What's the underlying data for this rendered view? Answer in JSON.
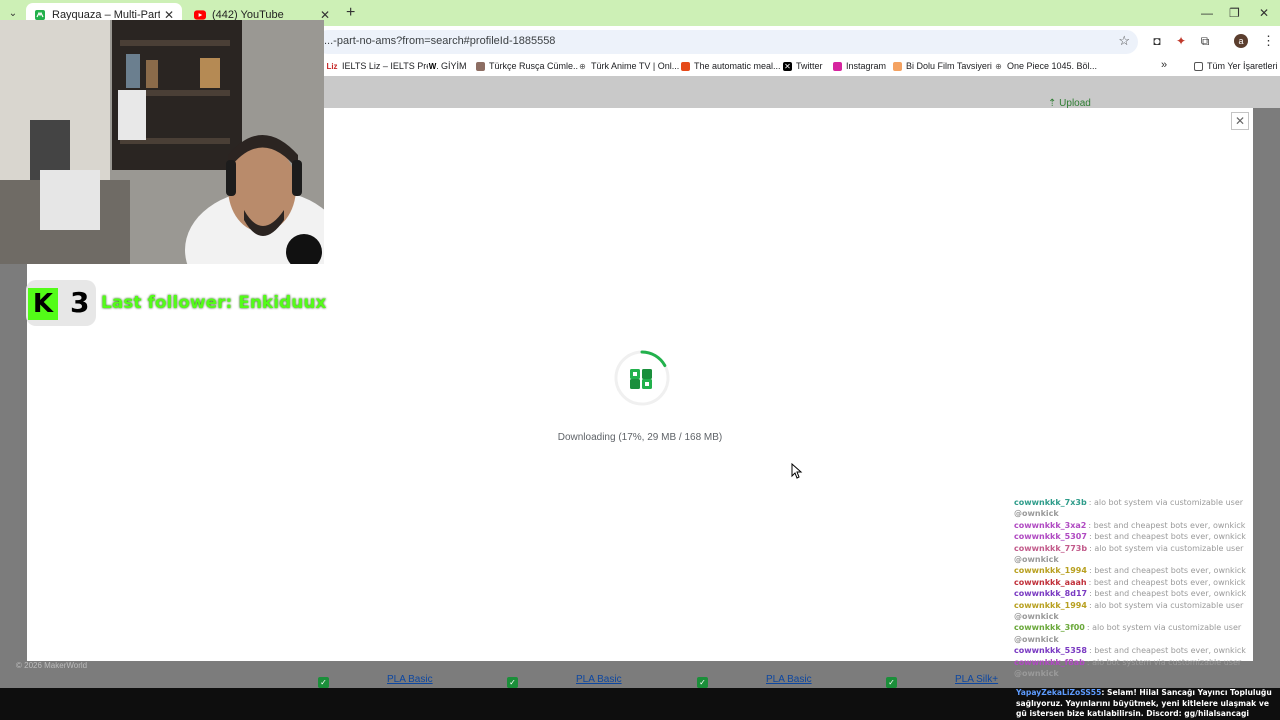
{
  "browser": {
    "tabs": [
      {
        "title": "Rayquaza – Multi-Part (No AMS",
        "active": true
      },
      {
        "title": "(442) YouTube",
        "active": false
      }
    ],
    "url": "...-part-no-ams?from=search#profileId-1885558",
    "bookmarks": [
      {
        "label": "IELTS Liz – IELTS Pre..."
      },
      {
        "label": "GİYİM"
      },
      {
        "label": "Türkçe Rusça Cümle..."
      },
      {
        "label": "Türk Anime TV | Onl..."
      },
      {
        "label": "The automatic meal..."
      },
      {
        "label": "Twitter"
      },
      {
        "label": "Instagram"
      },
      {
        "label": "Bi Dolu Film Tavsiyeri"
      },
      {
        "label": "One Piece 1045. Böl..."
      }
    ],
    "bookmarks_folder": "Tüm Yer İşaretleri",
    "profile_initial": "a"
  },
  "page": {
    "upload_label": "Upload",
    "copyright": "© 2026 MakerWorld",
    "filament_labels": [
      "PLA Basic",
      "PLA Basic",
      "PLA Basic",
      "PLA Silk+"
    ]
  },
  "modal": {
    "close_glyph": "✕",
    "status_text": "Downloading (17%, 29 MB / 168 MB)",
    "progress_fraction": 0.17,
    "accent_color": "#22b14c"
  },
  "stream": {
    "follower_count": "3",
    "last_follower": "Last follower: Enkiduux",
    "chat": [
      {
        "user": "cowwnkkk_7x3b",
        "msg": ": alo bot system via customizable user",
        "color": "#2e9c8a"
      },
      {
        "user": "@ownkick",
        "msg": "",
        "color": "#9a9a9a"
      },
      {
        "user": "cowwnkkk_3xa2",
        "msg": ": best and cheapest bots ever, ownkick",
        "color": "#b04ac2"
      },
      {
        "user": "cowwnkkk_5307",
        "msg": ": best and cheapest bots ever, ownkick",
        "color": "#b04ac2"
      },
      {
        "user": "cowwnkkk_773b",
        "msg": ": alo bot system via customizable user",
        "color": "#c25a8a"
      },
      {
        "user": "@ownkick",
        "msg": "",
        "color": "#9a9a9a"
      },
      {
        "user": "cowwnkkk_1994",
        "msg": ": best and cheapest bots ever, ownkick",
        "color": "#b8a020"
      },
      {
        "user": "cowwnkkk_aaah",
        "msg": ": best and cheapest bots ever, ownkick",
        "color": "#c0303a"
      },
      {
        "user": "cowwnkkk_8d17",
        "msg": ": best and cheapest bots ever, ownkick",
        "color": "#7a3ac2"
      },
      {
        "user": "cowwnkkk_1994",
        "msg": ": alo bot system via customizable user",
        "color": "#b8a020"
      },
      {
        "user": "@ownkick",
        "msg": "",
        "color": "#9a9a9a"
      },
      {
        "user": "cowwnkkk_3f00",
        "msg": ": alo bot system via customizable user",
        "color": "#6aa83a"
      },
      {
        "user": "@ownkick",
        "msg": "",
        "color": "#9a9a9a"
      },
      {
        "user": "cowwnkkk_5358",
        "msg": ": best and cheapest bots ever, ownkick",
        "color": "#7a3ac2"
      },
      {
        "user": "cowwnkkk_f8ab",
        "msg": ": alo bot system via customizable user",
        "color": "#b04ac2"
      },
      {
        "user": "@ownkick",
        "msg": "",
        "color": "#9a9a9a"
      }
    ],
    "pinned_user": "YapayZekaLiZoSS55",
    "pinned_msg": ": Selam! Hilal Sancağı Yayıncı Topluluğu sağlıyoruz. Yayınlarını büyütmek, yeni kitlelere ulaşmak ve gü istersen bize katılabilirsin. Discord: gg/hilalsancagi"
  }
}
